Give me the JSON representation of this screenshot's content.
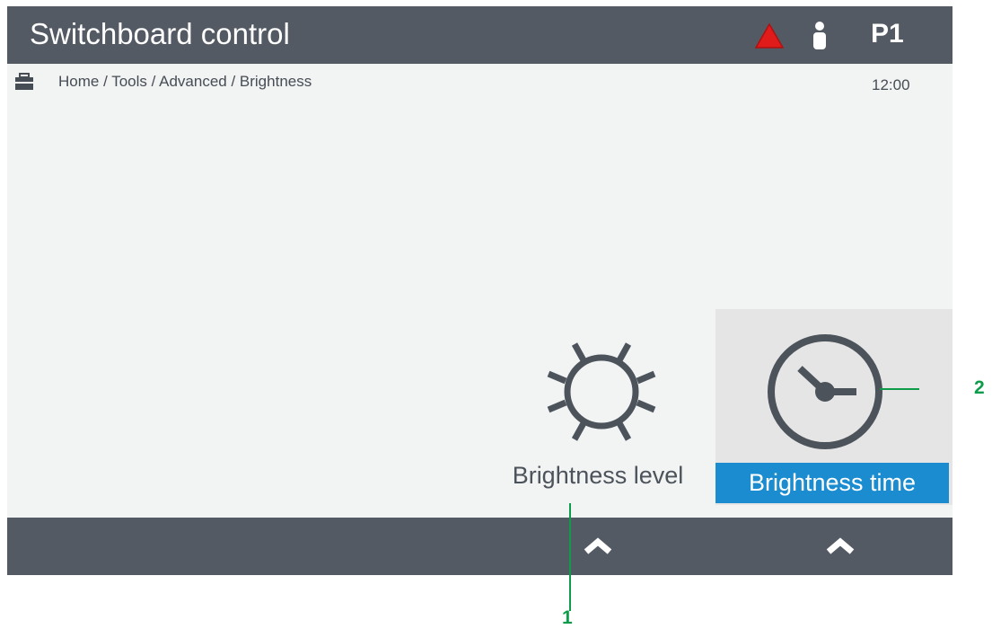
{
  "header": {
    "title": "Switchboard control",
    "alarm_icon": "alarm-triangle-icon",
    "alarm_color": "#e11a1a",
    "user_icon": "user-icon",
    "profile_code": "P1"
  },
  "breadcrumb": {
    "icon": "toolbox-icon",
    "path": "Home / Tools / Advanced / Brightness",
    "time": "12:00"
  },
  "tiles": [
    {
      "icon": "sun-icon",
      "label": "Brightness level",
      "selected": false
    },
    {
      "icon": "clock-icon",
      "label": "Brightness time",
      "selected": true
    }
  ],
  "footer": {
    "buttons": [
      "chevron-up-icon",
      "chevron-up-icon"
    ]
  },
  "callouts": [
    "1",
    "2"
  ],
  "colors": {
    "bar": "#535a63",
    "background": "#f2f3f3",
    "selected_tile": "#e5e5e5",
    "selected_label": "#1a8ccf",
    "callout": "#0e9b4a"
  }
}
